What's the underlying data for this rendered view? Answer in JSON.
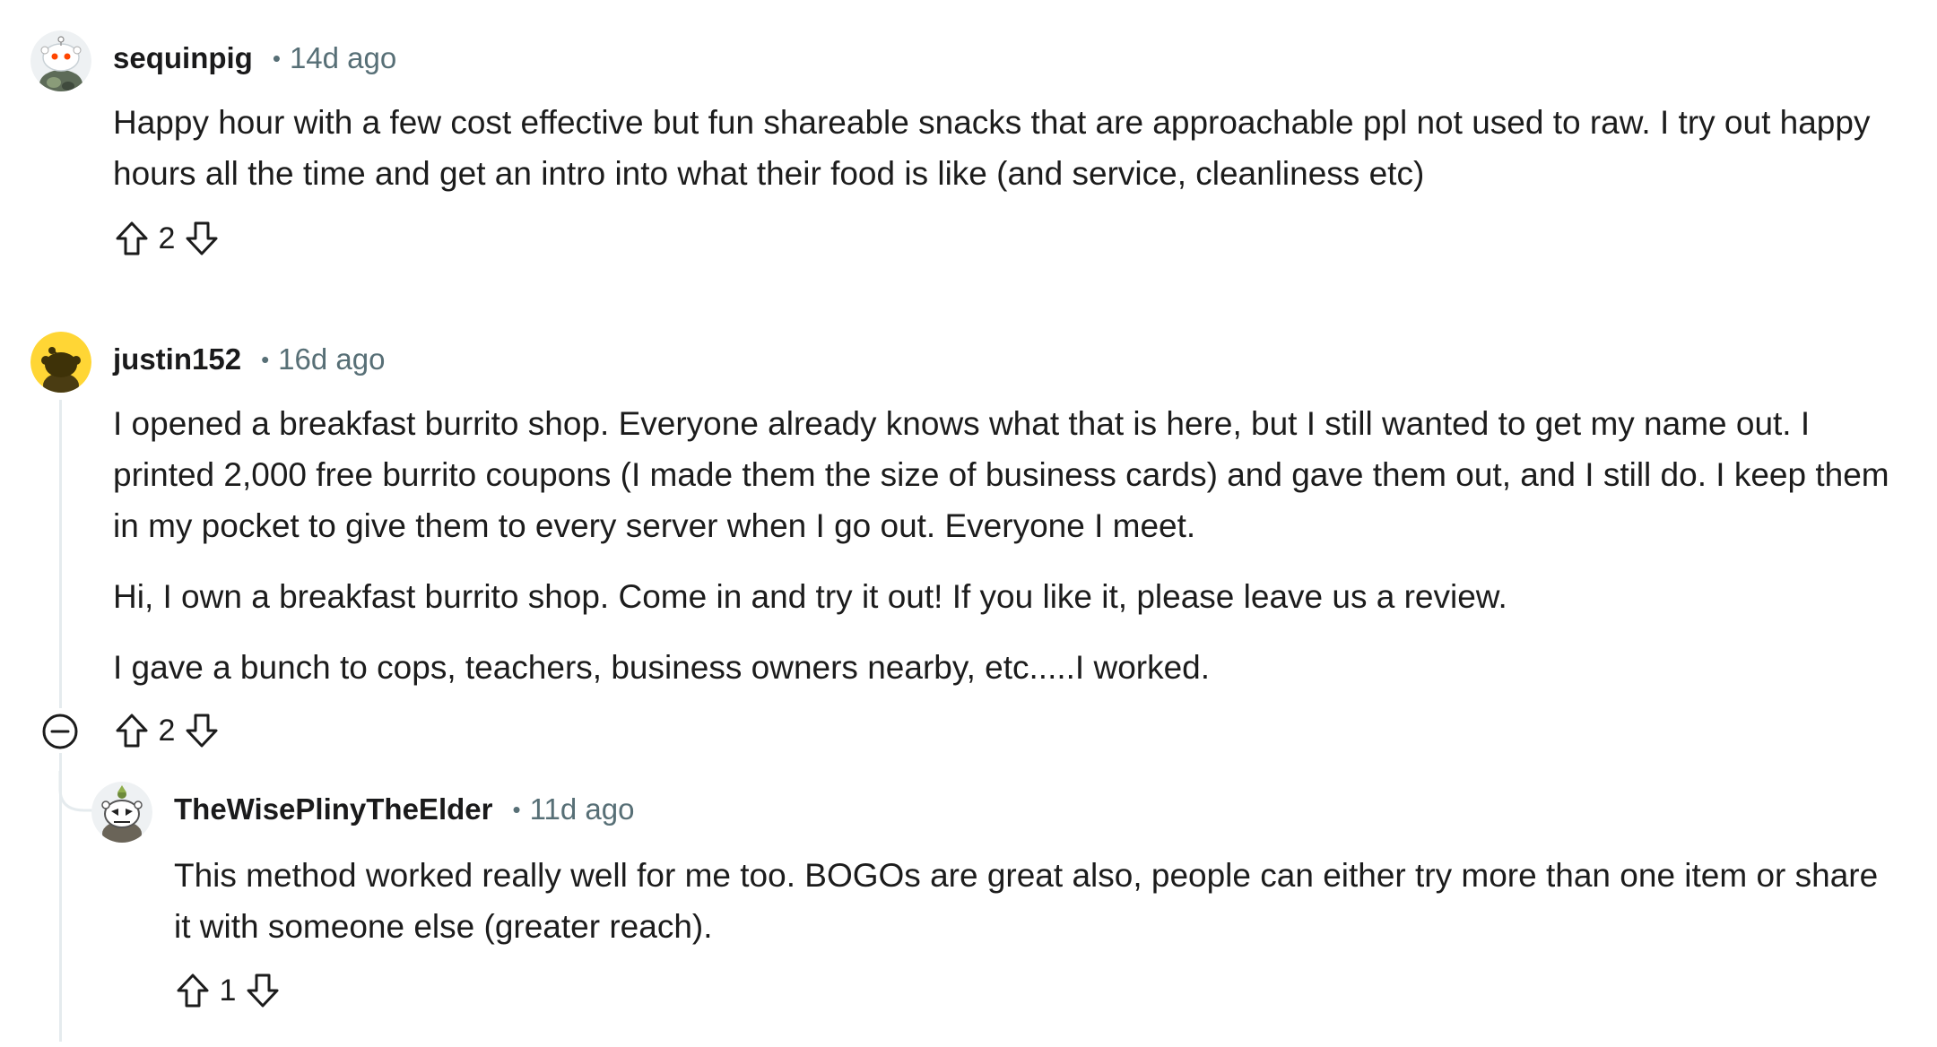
{
  "comments": [
    {
      "username": "sequinpig",
      "separator": "•",
      "time": "14d ago",
      "paragraphs": [
        "Happy hour with a few cost effective but fun shareable snacks that are approachable ppl not used to raw. I try out happy hours all the time and get an intro into what their food is like (and service, cleanliness etc)"
      ],
      "score": "2"
    },
    {
      "username": "justin152",
      "separator": "•",
      "time": "16d ago",
      "paragraphs": [
        "I opened a breakfast burrito shop. Everyone already knows what that is here, but I still wanted to get my name out. I printed 2,000 free burrito coupons (I made them the size of business cards) and gave them out, and I still do. I keep them in my pocket to give them to every server when I go out. Everyone I meet.",
        "Hi, I own a breakfast burrito shop. Come in and try it out! If you like it, please leave us a review.",
        "I gave a bunch to cops, teachers, business owners nearby, etc.....I worked."
      ],
      "score": "2"
    },
    {
      "username": "TheWisePlinyTheElder",
      "separator": "•",
      "time": "11d ago",
      "paragraphs": [
        "This method worked really well for me too. BOGOs are great also, people can either try more than one item or share it with someone else (greater reach)."
      ],
      "score": "1"
    }
  ],
  "icons": {
    "upvote": "upvote-arrow-icon",
    "downvote": "downvote-arrow-icon",
    "collapse": "collapse-minus-icon"
  },
  "colors": {
    "meta_gray": "#576f76",
    "thread_line": "#e5ebee",
    "avatar_yellow": "#ffd635"
  }
}
